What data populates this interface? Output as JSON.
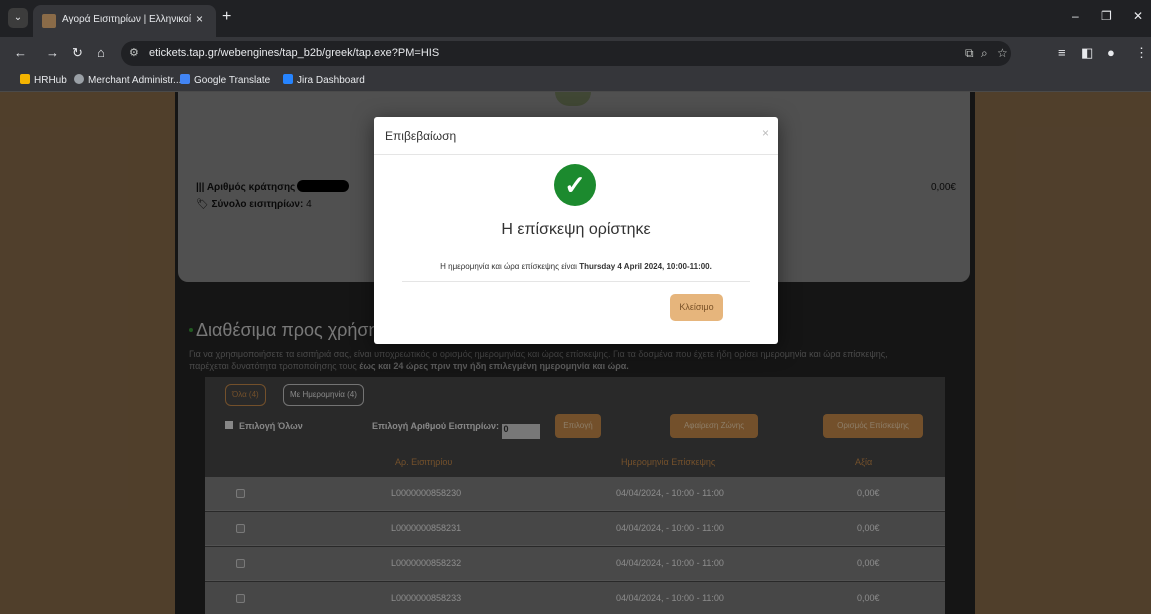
{
  "browser": {
    "tab_title": "Αγορά Εισιτηρίων | Ελληνικοί /",
    "tab_close": "×",
    "new_tab": "+",
    "url": "etickets.tap.gr/webengines/tap_b2b/greek/tap.exe?PM=HIS",
    "bookmarks": [
      {
        "label": "HRHub",
        "color": "#f4b400"
      },
      {
        "label": "Merchant Administr...",
        "color": "#9aa0a6"
      },
      {
        "label": "Google Translate",
        "color": "#4285f4"
      },
      {
        "label": "Jira Dashboard",
        "color": "#2684ff"
      }
    ]
  },
  "summary": {
    "booking_label": "Αριθμός κράτησης",
    "tickets_label": "Σύνολο εισιτηρίων:",
    "tickets_count": "4",
    "total_amount": "0,00€"
  },
  "available": {
    "title": "Διαθέσιμα προς χρήση",
    "info_1": "Για να χρησιμοποιήσετε τα εισιτήριά σας, είναι υποχρεωτικός ο ορισμός ημερομηνίας και ώρας επίσκεψης. Για τα δοσμένα που έχετε ήδη ορίσει ημερομηνία και ώρα επίσκεψης,",
    "info_2": "παρέχεται δυνατότητα τροποποίησης τους",
    "info_bold": "έως και 24 ώρες πριν την ήδη επιλεγμένη ημερομηνία και ώρα."
  },
  "panel": {
    "filter_all": "Όλα (4)",
    "filter_dated": "Με Ημερομηνία (4)",
    "select_all": "Επιλογή Όλων",
    "count_label": "Επιλογή Αριθμού Εισιτηρίων:",
    "count_value": "0",
    "btn_select": "Επιλογή",
    "btn_remove_zone": "Αφαίρεση Ζώνης",
    "btn_set_visit": "Ορισμός Επίσκεψης",
    "columns": [
      "Αρ. Εισιτηρίου",
      "Ημερομηνία Επίσκεψης",
      "Αξία"
    ],
    "rows": [
      {
        "ticket": "L0000000858230",
        "date": "04/04/2024, - 10:00 - 11:00",
        "value": "0,00€"
      },
      {
        "ticket": "L0000000858231",
        "date": "04/04/2024, - 10:00 - 11:00",
        "value": "0,00€"
      },
      {
        "ticket": "L0000000858232",
        "date": "04/04/2024, - 10:00 - 11:00",
        "value": "0,00€"
      },
      {
        "ticket": "L0000000858233",
        "date": "04/04/2024, - 10:00 - 11:00",
        "value": "0,00€"
      }
    ]
  },
  "modal": {
    "title": "Επιβεβαίωση",
    "close": "×",
    "check": "✓",
    "heading": "Η επίσκεψη ορίστηκε",
    "desc_prefix": "Η ημερομηνία και ώρα επίσκεψης είναι",
    "desc_bold": "Thursday 4 April 2024, 10:00-11:00.",
    "close_button": "Κλείσιμο"
  },
  "colors": {
    "page_bg": "#8a6d4b",
    "accent": "#c68a4a",
    "success": "#1c8a2e"
  }
}
